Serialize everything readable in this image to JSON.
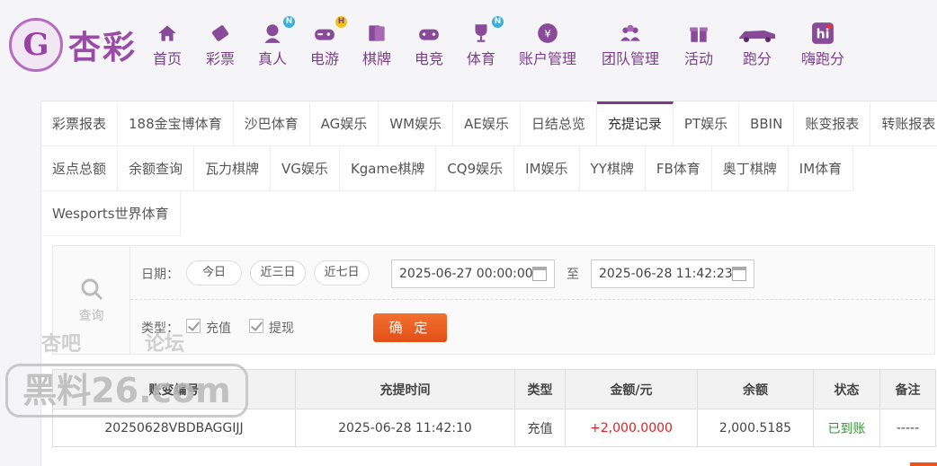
{
  "logo": {
    "text": "杏彩",
    "emblem": "G"
  },
  "nav": [
    {
      "label": "首页",
      "icon": "home-icon"
    },
    {
      "label": "彩票",
      "icon": "ticket-icon"
    },
    {
      "label": "真人",
      "icon": "dealer-icon",
      "badge": "N"
    },
    {
      "label": "电游",
      "icon": "gamepad-icon",
      "badge": "H"
    },
    {
      "label": "棋牌",
      "icon": "cards-icon"
    },
    {
      "label": "电竞",
      "icon": "controller-icon"
    },
    {
      "label": "体育",
      "icon": "trophy-icon",
      "badge": "N"
    },
    {
      "label": "账户管理",
      "icon": "account-icon"
    },
    {
      "label": "团队管理",
      "icon": "team-icon"
    },
    {
      "label": "活动",
      "icon": "gift-icon"
    },
    {
      "label": "跑分",
      "icon": "car-icon"
    },
    {
      "label": "嗨跑分",
      "icon": "hi-icon"
    }
  ],
  "tabs_row1": [
    "彩票报表",
    "188金宝博体育",
    "沙巴体育",
    "AG娱乐",
    "WM娱乐",
    "AE娱乐",
    "日结总览",
    "充提记录",
    "PT娱乐",
    "BBIN",
    "账变报表",
    "转账报表"
  ],
  "tabs_row2": [
    "返点总额",
    "余额查询",
    "瓦力棋牌",
    "VG娱乐",
    "Kgame棋牌",
    "CQ9娱乐",
    "IM娱乐",
    "YY棋牌",
    "FB体育",
    "奥丁棋牌",
    "IM体育"
  ],
  "tabs_row3": [
    "Wesports世界体育"
  ],
  "active_tab": "充提记录",
  "query": {
    "search_label": "查询",
    "date_label": "日期：",
    "today": "今日",
    "last3": "近三日",
    "last7": "近七日",
    "start": "2025-06-27 00:00:00",
    "to": "至",
    "end": "2025-06-28 11:42:23",
    "type_label": "类型：",
    "deposit": "充值",
    "withdraw": "提现",
    "confirm": "确 定"
  },
  "table": {
    "headers": [
      "账变编号",
      "充提时间",
      "类型",
      "金额/元",
      "余额",
      "状态",
      "备注"
    ],
    "rows": [
      [
        "20250628VBDBAGGIJJ",
        "2025-06-28 11:42:10",
        "充值",
        "+2,000.0000",
        "2,000.5185",
        "已到账",
        "-----"
      ]
    ]
  },
  "watermark": {
    "line1a": "杏吧",
    "line1b": "论坛",
    "main": "黑料26.com"
  },
  "colors": {
    "brand": "#7b3a8e",
    "accent": "#e8551f",
    "amount": "#e02020",
    "success": "#2e9a2e"
  }
}
